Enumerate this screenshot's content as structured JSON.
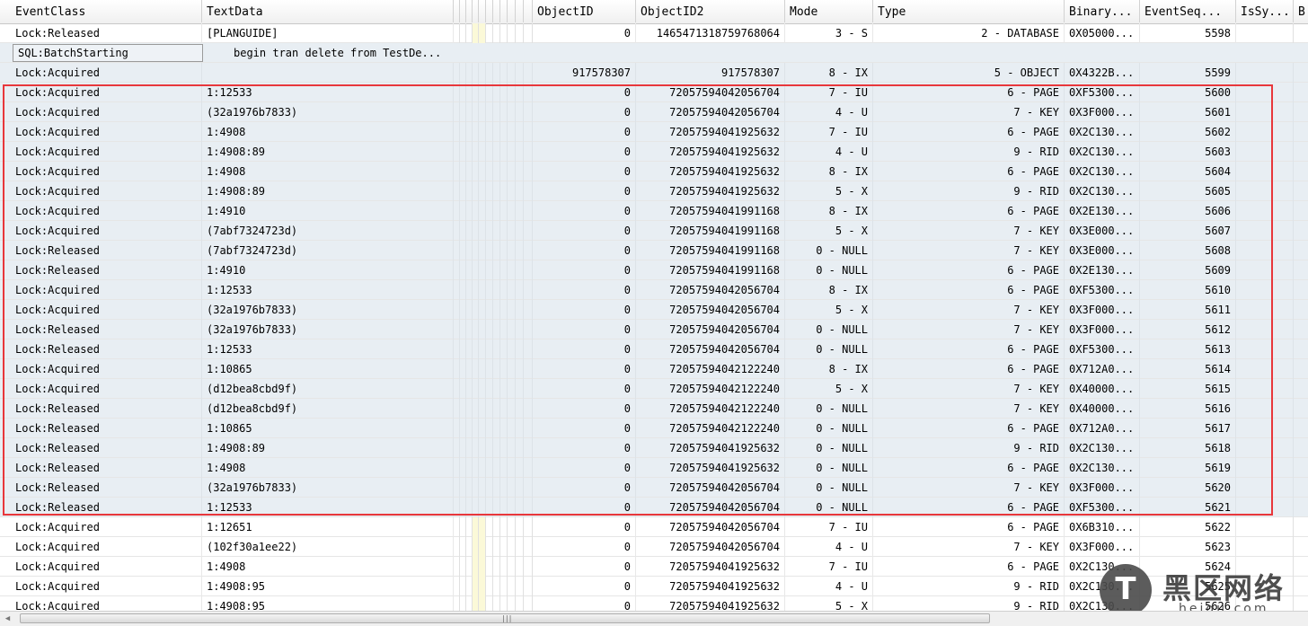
{
  "columns": {
    "eventclass": "EventClass",
    "textdata": "TextData",
    "objectid": "ObjectID",
    "objectid2": "ObjectID2",
    "mode": "Mode",
    "type": "Type",
    "binary": "Binary...",
    "eventseq": "EventSeq...",
    "issy": "IsSy...",
    "extra": "B"
  },
  "rows": [
    {
      "ec": "Lock:Released",
      "td": "[PLANGUIDE]",
      "oid": "0",
      "oid2": "1465471318759768064⁠",
      "mode": "3 - S",
      "type": "2 - DATABASE",
      "bin": "0X05000...",
      "seq": "5598"
    },
    {
      "ec": "SQL:BatchStarting",
      "td": "begin tran   delete from TestDe...",
      "oid": "",
      "oid2": "",
      "mode": "",
      "type": "",
      "bin": "",
      "seq": ""
    },
    {
      "ec": "Lock:Acquired",
      "td": "",
      "oid": "917578307",
      "oid2": "917578307",
      "mode": "8 - IX",
      "type": "5 - OBJECT",
      "bin": "0X4322B...",
      "seq": "5599"
    },
    {
      "ec": "Lock:Acquired",
      "td": "1:12533",
      "oid": "0",
      "oid2": "72057594042056704",
      "mode": "7 - IU",
      "type": "6 - PAGE",
      "bin": "0XF5300...",
      "seq": "5600"
    },
    {
      "ec": "Lock:Acquired",
      "td": "(32a1976b7833)",
      "oid": "0",
      "oid2": "72057594042056704",
      "mode": "4 - U",
      "type": "7 - KEY",
      "bin": "0X3F000...",
      "seq": "5601"
    },
    {
      "ec": "Lock:Acquired",
      "td": "1:4908",
      "oid": "0",
      "oid2": "72057594041925632",
      "mode": "7 - IU",
      "type": "6 - PAGE",
      "bin": "0X2C130...",
      "seq": "5602"
    },
    {
      "ec": "Lock:Acquired",
      "td": "1:4908:89",
      "oid": "0",
      "oid2": "72057594041925632",
      "mode": "4 - U",
      "type": "9 - RID",
      "bin": "0X2C130...",
      "seq": "5603"
    },
    {
      "ec": "Lock:Acquired",
      "td": "1:4908",
      "oid": "0",
      "oid2": "72057594041925632",
      "mode": "8 - IX",
      "type": "6 - PAGE",
      "bin": "0X2C130...",
      "seq": "5604"
    },
    {
      "ec": "Lock:Acquired",
      "td": "1:4908:89",
      "oid": "0",
      "oid2": "72057594041925632",
      "mode": "5 - X",
      "type": "9 - RID",
      "bin": "0X2C130...",
      "seq": "5605"
    },
    {
      "ec": "Lock:Acquired",
      "td": "1:4910",
      "oid": "0",
      "oid2": "72057594041991168",
      "mode": "8 - IX",
      "type": "6 - PAGE",
      "bin": "0X2E130...",
      "seq": "5606"
    },
    {
      "ec": "Lock:Acquired",
      "td": "(7abf7324723d)",
      "oid": "0",
      "oid2": "72057594041991168",
      "mode": "5 - X",
      "type": "7 - KEY",
      "bin": "0X3E000...",
      "seq": "5607"
    },
    {
      "ec": "Lock:Released",
      "td": "(7abf7324723d)",
      "oid": "0",
      "oid2": "72057594041991168",
      "mode": "0 - NULL",
      "type": "7 - KEY",
      "bin": "0X3E000...",
      "seq": "5608"
    },
    {
      "ec": "Lock:Released",
      "td": "1:4910",
      "oid": "0",
      "oid2": "72057594041991168",
      "mode": "0 - NULL",
      "type": "6 - PAGE",
      "bin": "0X2E130...",
      "seq": "5609"
    },
    {
      "ec": "Lock:Acquired",
      "td": "1:12533",
      "oid": "0",
      "oid2": "72057594042056704",
      "mode": "8 - IX",
      "type": "6 - PAGE",
      "bin": "0XF5300...",
      "seq": "5610"
    },
    {
      "ec": "Lock:Acquired",
      "td": "(32a1976b7833)",
      "oid": "0",
      "oid2": "72057594042056704",
      "mode": "5 - X",
      "type": "7 - KEY",
      "bin": "0X3F000...",
      "seq": "5611"
    },
    {
      "ec": "Lock:Released",
      "td": "(32a1976b7833)",
      "oid": "0",
      "oid2": "72057594042056704",
      "mode": "0 - NULL",
      "type": "7 - KEY",
      "bin": "0X3F000...",
      "seq": "5612"
    },
    {
      "ec": "Lock:Released",
      "td": "1:12533",
      "oid": "0",
      "oid2": "72057594042056704",
      "mode": "0 - NULL",
      "type": "6 - PAGE",
      "bin": "0XF5300...",
      "seq": "5613"
    },
    {
      "ec": "Lock:Acquired",
      "td": "1:10865",
      "oid": "0",
      "oid2": "72057594042122240",
      "mode": "8 - IX",
      "type": "6 - PAGE",
      "bin": "0X712A0...",
      "seq": "5614"
    },
    {
      "ec": "Lock:Acquired",
      "td": "(d12bea8cbd9f)",
      "oid": "0",
      "oid2": "72057594042122240",
      "mode": "5 - X",
      "type": "7 - KEY",
      "bin": "0X40000...",
      "seq": "5615"
    },
    {
      "ec": "Lock:Released",
      "td": "(d12bea8cbd9f)",
      "oid": "0",
      "oid2": "72057594042122240",
      "mode": "0 - NULL",
      "type": "7 - KEY",
      "bin": "0X40000...",
      "seq": "5616"
    },
    {
      "ec": "Lock:Released",
      "td": "1:10865",
      "oid": "0",
      "oid2": "72057594042122240",
      "mode": "0 - NULL",
      "type": "6 - PAGE",
      "bin": "0X712A0...",
      "seq": "5617"
    },
    {
      "ec": "Lock:Released",
      "td": "1:4908:89",
      "oid": "0",
      "oid2": "72057594041925632",
      "mode": "0 - NULL",
      "type": "9 - RID",
      "bin": "0X2C130...",
      "seq": "5618"
    },
    {
      "ec": "Lock:Released",
      "td": "1:4908",
      "oid": "0",
      "oid2": "72057594041925632",
      "mode": "0 - NULL",
      "type": "6 - PAGE",
      "bin": "0X2C130...",
      "seq": "5619"
    },
    {
      "ec": "Lock:Released",
      "td": "(32a1976b7833)",
      "oid": "0",
      "oid2": "72057594042056704",
      "mode": "0 - NULL",
      "type": "7 - KEY",
      "bin": "0X3F000...",
      "seq": "5620"
    },
    {
      "ec": "Lock:Released",
      "td": "1:12533",
      "oid": "0",
      "oid2": "72057594042056704",
      "mode": "0 - NULL",
      "type": "6 - PAGE",
      "bin": "0XF5300...",
      "seq": "5621"
    },
    {
      "ec": "Lock:Acquired",
      "td": "1:12651",
      "oid": "0",
      "oid2": "72057594042056704",
      "mode": "7 - IU",
      "type": "6 - PAGE",
      "bin": "0X6B310...",
      "seq": "5622"
    },
    {
      "ec": "Lock:Acquired",
      "td": "(102f30a1ee22)",
      "oid": "0",
      "oid2": "72057594042056704",
      "mode": "4 - U",
      "type": "7 - KEY",
      "bin": "0X3F000...",
      "seq": "5623"
    },
    {
      "ec": "Lock:Acquired",
      "td": "1:4908",
      "oid": "0",
      "oid2": "72057594041925632",
      "mode": "7 - IU",
      "type": "6 - PAGE",
      "bin": "0X2C130...",
      "seq": "5624"
    },
    {
      "ec": "Lock:Acquired",
      "td": "1:4908:95",
      "oid": "0",
      "oid2": "72057594041925632",
      "mode": "4 - U",
      "type": "9 - RID",
      "bin": "0X2C130...",
      "seq": "5625"
    },
    {
      "ec": "Lock:Acquired",
      "td": "1:4908:95",
      "oid": "0",
      "oid2": "72057594041925632",
      "mode": "5 - X",
      "type": "9 - RID",
      "bin": "0X2C130...",
      "seq": "5626"
    }
  ],
  "watermark": {
    "icon_glyph": "T",
    "title": "黑区网络",
    "subtitle": "heiqu.com"
  },
  "colors": {
    "highlight": "#e8373b",
    "selected_row": "#e8eef3",
    "narrow_col_yellow": "#fbf9d8"
  }
}
